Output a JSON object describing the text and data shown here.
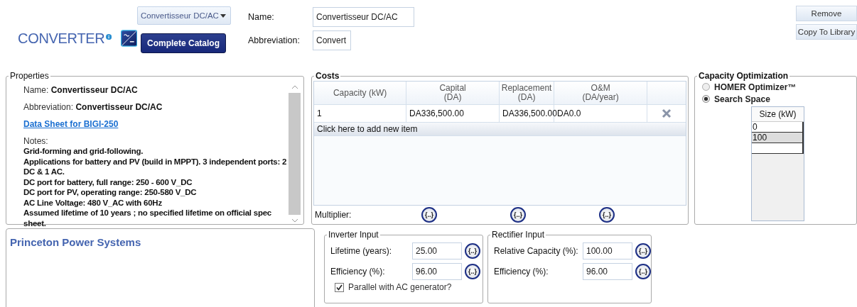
{
  "header": {
    "title": "CONVERTER",
    "dropdown": {
      "value": "Convertisseur DC/AC"
    },
    "catalog_button": "Complete Catalog",
    "name_label": "Name:",
    "name_value": "Convertisseur DC/AC",
    "abbreviation_label": "Abbreviation:",
    "abbreviation_value": "Convert",
    "buttons": [
      "Remove",
      "Copy To Library"
    ]
  },
  "properties": {
    "legend": "Properties",
    "name_label": "Name:",
    "name_value": "Convertisseur DC/AC",
    "abbreviation_label": "Abbreviation:",
    "abbreviation_value": "Convertisseur DC/AC",
    "link": "Data Sheet for BIGI-250",
    "notes_label": "Notes:",
    "notes": [
      "Grid-forming and grid-following.",
      "Applications for battery and PV (build in MPPT).  3 independent ports: 2 DC & 1 AC.",
      "DC port for battery, full range: 250 - 600 V_DC",
      "DC port for PV, operating range: 250-580 V_DC",
      "AC Line Voltage: 480 V_AC with 60Hz",
      "Assumed lifetime of 10 years ; no specified lifetime on official spec sheet."
    ]
  },
  "costs": {
    "legend": "Costs",
    "columns": [
      {
        "label": "Capacity (kW)"
      },
      {
        "label": "Capital",
        "unit": "(DA)"
      },
      {
        "label": "Replacement",
        "unit": "(DA)"
      },
      {
        "label": "O&M",
        "unit": "(DA/year)"
      }
    ],
    "rows": [
      [
        "1",
        "DA336,500.00",
        "DA336,500.00",
        "DA0.0"
      ]
    ],
    "add_item": "Click here to add new item",
    "multiplier_label": "Multiplier:",
    "multiplier_buttons": [
      "{..}",
      "{..}",
      "{..}"
    ]
  },
  "capacity_optimization": {
    "legend": "Capacity Optimization",
    "options": [
      {
        "label": "HOMER Optimizer™",
        "selected": false
      },
      {
        "label": "Search Space",
        "selected": true
      }
    ],
    "size_header": "Size (kW)",
    "sizes": [
      {
        "value": "0",
        "selected": false
      },
      {
        "value": "100",
        "selected": true
      }
    ]
  },
  "manufacturer": {
    "name": "Princeton Power Systems"
  },
  "inverter_input": {
    "legend": "Inverter Input",
    "fields": [
      {
        "label": "Lifetime (years):",
        "value": "25.00",
        "button": "{..}"
      },
      {
        "label": "Efficiency (%):",
        "value": "96.00",
        "button": "{..}"
      }
    ],
    "parallel": {
      "label": "Parallel with AC generator?",
      "checked": true
    }
  },
  "rectifier_input": {
    "legend": "Rectifier Input",
    "fields": [
      {
        "label": "Relative Capacity (%):",
        "value": "100.00",
        "button": "{..}"
      },
      {
        "label": "Efficiency (%):",
        "value": "96.00",
        "button": "{..}"
      }
    ]
  }
}
